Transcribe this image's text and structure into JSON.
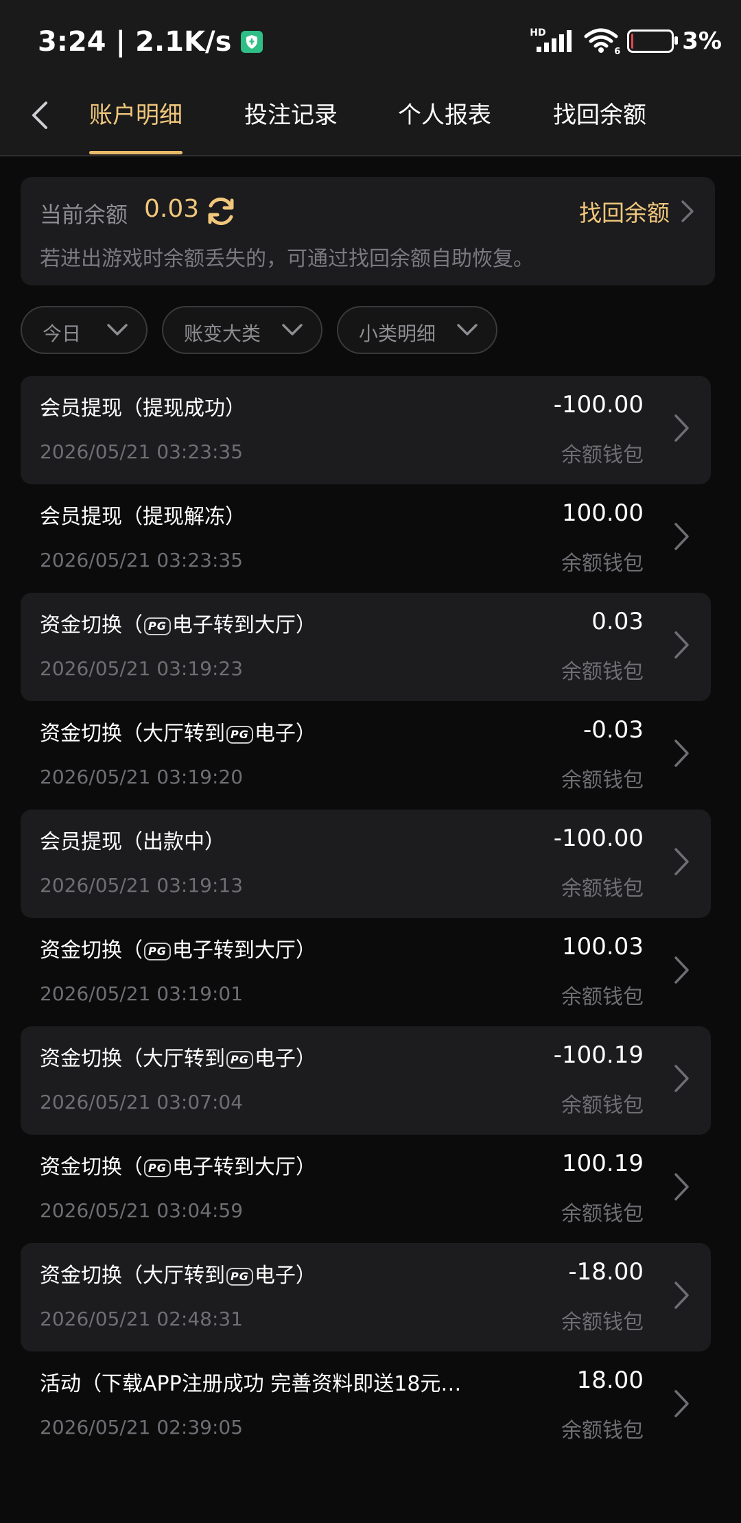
{
  "status_bar": {
    "time": "3:24",
    "separator": "|",
    "net_speed": "2.1K/s",
    "network_type": "HD",
    "wifi_badge": "6",
    "battery_percent": "3%",
    "battery_level": 0.03,
    "icons": [
      "shield-icon",
      "signal-icon",
      "wifi-icon",
      "battery-icon"
    ]
  },
  "nav": {
    "tabs": [
      {
        "label": "账户明细",
        "active": true
      },
      {
        "label": "投注记录",
        "active": false
      },
      {
        "label": "个人报表",
        "active": false
      },
      {
        "label": "找回余额",
        "active": false
      }
    ],
    "accent_color": "#f0c77c"
  },
  "balance": {
    "label": "当前余额",
    "value": "0.03",
    "recover_label": "找回余额",
    "hint": "若进出游戏时余额丢失的，可通过找回余额自助恢复。"
  },
  "filters": [
    {
      "label": "今日"
    },
    {
      "label": "账变大类"
    },
    {
      "label": "小类明细"
    }
  ],
  "records": [
    {
      "title": "会员提现（提现成功）",
      "time": "2026/05/21 03:23:35",
      "amount": "-100.00",
      "wallet": "余额钱包"
    },
    {
      "title": "会员提现（提现解冻）",
      "time": "2026/05/21 03:23:35",
      "amount": "100.00",
      "wallet": "余额钱包"
    },
    {
      "title_pre": "资金切换（",
      "title_post": "电子转到大厅）",
      "time": "2026/05/21 03:19:23",
      "amount": "0.03",
      "wallet": "余额钱包"
    },
    {
      "title_pre": "资金切换（大厅转到",
      "title_post": "电子）",
      "time": "2026/05/21 03:19:20",
      "amount": "-0.03",
      "wallet": "余额钱包"
    },
    {
      "title": "会员提现（出款中）",
      "time": "2026/05/21 03:19:13",
      "amount": "-100.00",
      "wallet": "余额钱包"
    },
    {
      "title_pre": "资金切换（",
      "title_post": "电子转到大厅）",
      "time": "2026/05/21 03:19:01",
      "amount": "100.03",
      "wallet": "余额钱包"
    },
    {
      "title_pre": "资金切换（大厅转到",
      "title_post": "电子）",
      "time": "2026/05/21 03:07:04",
      "amount": "-100.19",
      "wallet": "余额钱包"
    },
    {
      "title_pre": "资金切换（",
      "title_post": "电子转到大厅）",
      "time": "2026/05/21 03:04:59",
      "amount": "100.19",
      "wallet": "余额钱包"
    },
    {
      "title_pre": "资金切换（大厅转到",
      "title_post": "电子）",
      "time": "2026/05/21 02:48:31",
      "amount": "-18.00",
      "wallet": "余额钱包"
    },
    {
      "title": "活动（下载APP注册成功 完善资料即送18元…",
      "time": "2026/05/21 02:39:05",
      "amount": "18.00",
      "wallet": "余额钱包"
    }
  ],
  "pg_logo": "PG"
}
